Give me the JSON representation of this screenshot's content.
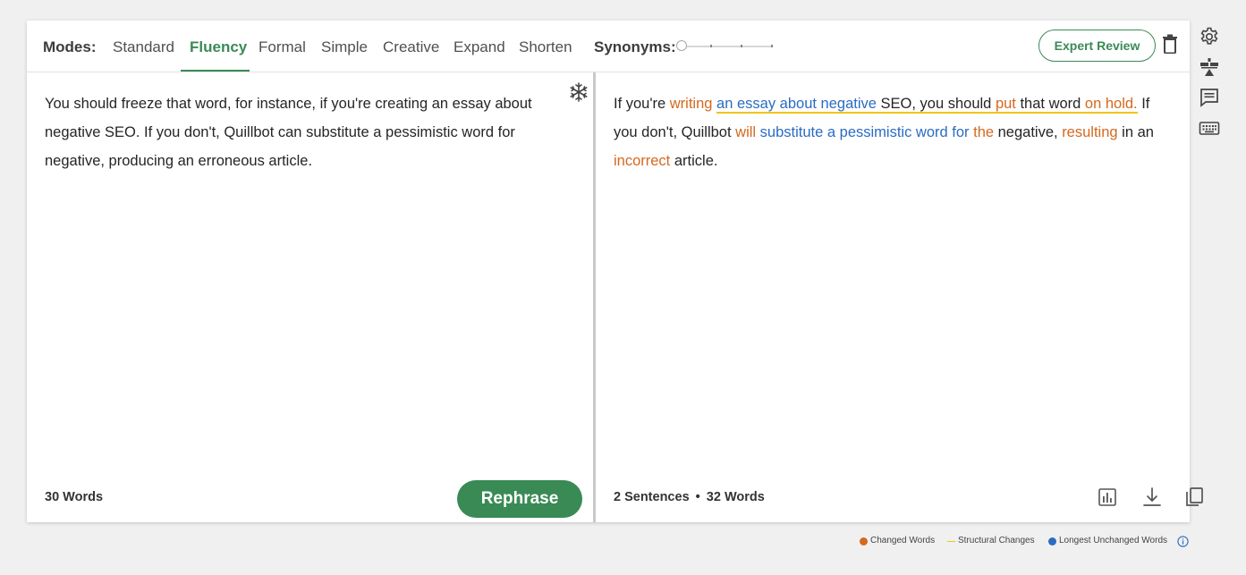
{
  "toolbar": {
    "modes_label": "Modes:",
    "modes": [
      "Standard",
      "Fluency",
      "Formal",
      "Simple",
      "Creative",
      "Expand",
      "Shorten"
    ],
    "active_mode": "Fluency",
    "synonyms_label": "Synonyms:",
    "synonyms_level": 0,
    "expert_review_label": "Expert Review"
  },
  "input": {
    "text": "You should freeze that word, for instance, if you're creating an essay about negative SEO. If you don't, Quillbot can substitute a pessimistic word for negative, producing an erroneous article.",
    "word_count": "30 Words",
    "rephrase_label": "Rephrase"
  },
  "output": {
    "segments": [
      {
        "text": "If you're ",
        "type": "plain"
      },
      {
        "text": "writing",
        "type": "changed"
      },
      {
        "text": " ",
        "type": "plain"
      },
      {
        "text": "an essay about negative",
        "type": "unchanged",
        "structural": true
      },
      {
        "text": " SEO, you should ",
        "type": "plain",
        "structural": true
      },
      {
        "text": "put",
        "type": "changed",
        "structural": true
      },
      {
        "text": " that word ",
        "type": "plain",
        "structural": true
      },
      {
        "text": "on hold.",
        "type": "changed",
        "structural": true
      },
      {
        "text": " If you don't, Quillbot ",
        "type": "plain"
      },
      {
        "text": "will",
        "type": "changed"
      },
      {
        "text": " ",
        "type": "plain"
      },
      {
        "text": "substitute a pessimistic word for",
        "type": "unchanged"
      },
      {
        "text": " ",
        "type": "plain"
      },
      {
        "text": "the",
        "type": "changed"
      },
      {
        "text": " negative, ",
        "type": "plain"
      },
      {
        "text": "resulting",
        "type": "changed"
      },
      {
        "text": " in an ",
        "type": "plain"
      },
      {
        "text": "incorrect",
        "type": "changed"
      },
      {
        "text": " article.",
        "type": "plain"
      }
    ],
    "sentence_count": "2 Sentences",
    "bullet": "•",
    "word_count": "32 Words"
  },
  "legend": {
    "changed": "Changed Words",
    "structural": "Structural Changes",
    "unchanged": "Longest Unchanged Words"
  },
  "colors": {
    "accent": "#3a8a55",
    "changed": "#d4681d",
    "structural": "#f0c419",
    "unchanged": "#2a6cc2"
  },
  "icons": {
    "sidebar": [
      "gear-icon",
      "compare-icon",
      "comment-icon",
      "keyboard-icon"
    ],
    "output_actions": [
      "stats-icon",
      "download-icon",
      "copy-icon"
    ],
    "other": [
      "trash-icon",
      "freeze-icon",
      "info-icon"
    ]
  }
}
